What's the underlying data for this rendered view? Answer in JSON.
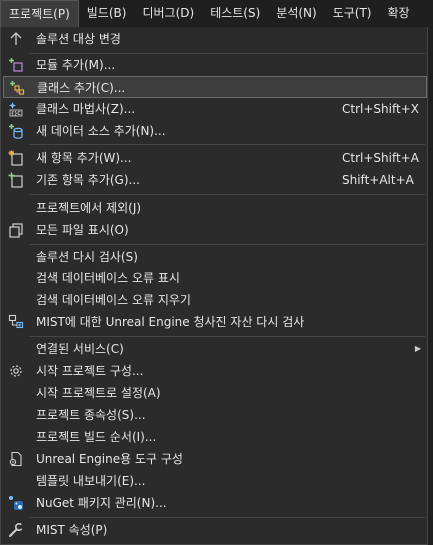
{
  "menubar": {
    "items": [
      {
        "label": "프로젝트(P)"
      },
      {
        "label": "빌드(B)"
      },
      {
        "label": "디버그(D)"
      },
      {
        "label": "테스트(S)"
      },
      {
        "label": "분석(N)"
      },
      {
        "label": "도구(T)"
      },
      {
        "label": "확장"
      }
    ]
  },
  "menu": {
    "items": [
      {
        "label": "솔루션 대상 변경",
        "shortcut": "",
        "icon": "arrow-up-icon"
      },
      {
        "label": "모듈 추가(M)...",
        "shortcut": "",
        "icon": "add-module-icon"
      },
      {
        "label": "클래스 추가(C)...",
        "shortcut": "",
        "icon": "add-class-icon"
      },
      {
        "label": "클래스 마법사(Z)...",
        "shortcut": "Ctrl+Shift+X",
        "icon": "class-wizard-icon"
      },
      {
        "label": "새 데이터 소스 추가(N)...",
        "shortcut": "",
        "icon": "add-data-source-icon"
      },
      {
        "label": "새 항목 추가(W)...",
        "shortcut": "Ctrl+Shift+A",
        "icon": "new-item-icon"
      },
      {
        "label": "기존 항목 추가(G)...",
        "shortcut": "Shift+Alt+A",
        "icon": "existing-item-icon"
      },
      {
        "label": "프로젝트에서 제외(J)",
        "shortcut": "",
        "icon": ""
      },
      {
        "label": "모든 파일 표시(O)",
        "shortcut": "",
        "icon": "show-all-files-icon"
      },
      {
        "label": "솔루션 다시 검사(S)",
        "shortcut": "",
        "icon": ""
      },
      {
        "label": "검색 데이터베이스 오류 표시",
        "shortcut": "",
        "icon": ""
      },
      {
        "label": "검색 데이터베이스 오류 지우기",
        "shortcut": "",
        "icon": ""
      },
      {
        "label": "MIST에 대한 Unreal Engine 청사진 자산 다시 검사",
        "shortcut": "",
        "icon": "unreal-blueprint-icon"
      },
      {
        "label": "연결된 서비스(C)",
        "shortcut": "",
        "icon": ""
      },
      {
        "label": "시작 프로젝트 구성...",
        "shortcut": "",
        "icon": "gear-icon"
      },
      {
        "label": "시작 프로젝트로 설정(A)",
        "shortcut": "",
        "icon": ""
      },
      {
        "label": "프로젝트 종속성(S)...",
        "shortcut": "",
        "icon": ""
      },
      {
        "label": "프로젝트 빌드 순서(I)...",
        "shortcut": "",
        "icon": ""
      },
      {
        "label": "Unreal Engine용 도구 구성",
        "shortcut": "",
        "icon": "unreal-tools-icon"
      },
      {
        "label": "템플릿 내보내기(E)...",
        "shortcut": "",
        "icon": ""
      },
      {
        "label": "NuGet 패키지 관리(N)...",
        "shortcut": "",
        "icon": "nuget-icon"
      },
      {
        "label": "MIST 속성(P)",
        "shortcut": "",
        "icon": "wrench-icon"
      }
    ]
  },
  "colors": {
    "background": "#1f1f1f",
    "menu_background": "#2b2b2b",
    "highlight": "#3d3d3d",
    "text": "#e6e6e6",
    "icon_purple": "#b180d7",
    "icon_green": "#89d185",
    "icon_blue": "#75beff"
  }
}
